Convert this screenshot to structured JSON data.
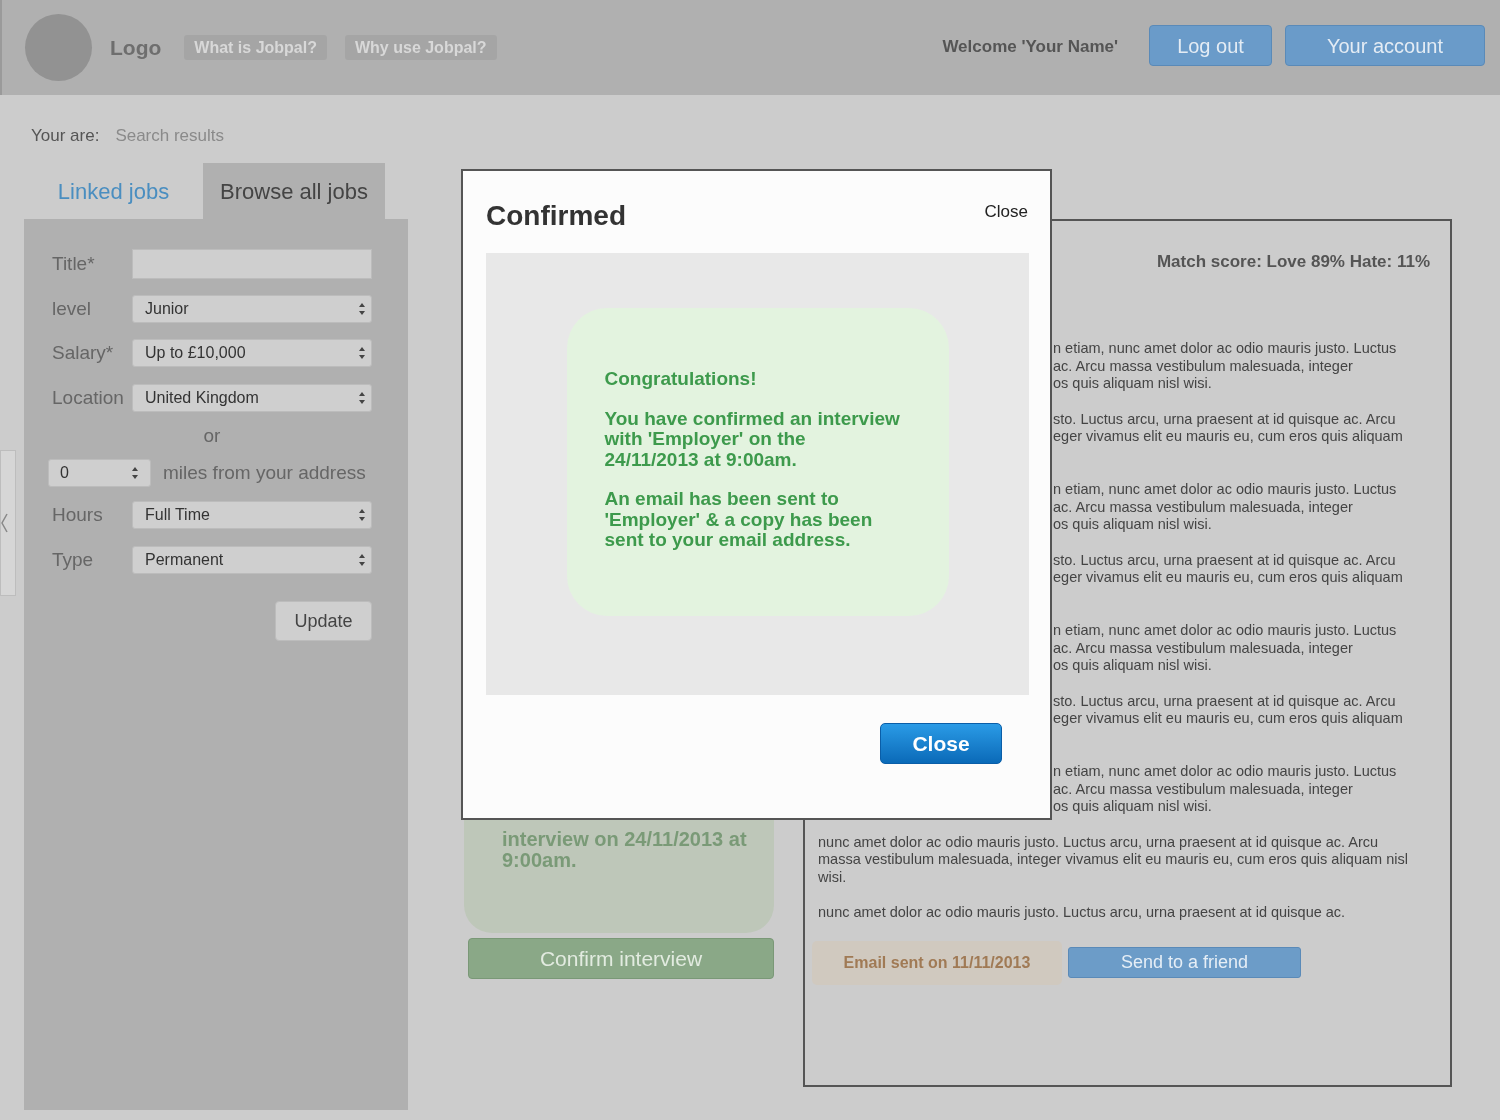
{
  "header": {
    "logo": "Logo",
    "nav": [
      "What is Jobpal?",
      "Why use Jobpal?"
    ],
    "welcome": "Welcome 'Your Name'",
    "buttons": [
      "Log out",
      "Your account"
    ]
  },
  "breadcrumb": {
    "label": "Your are:",
    "current": "Search results"
  },
  "tabs": [
    {
      "label": "Linked jobs",
      "selected": false
    },
    {
      "label": "Browse all jobs",
      "selected": true
    }
  ],
  "filters": [
    {
      "kind": "text",
      "label": "Title*"
    },
    {
      "kind": "select",
      "label": "level",
      "value": "Junior"
    },
    {
      "kind": "select",
      "label": "Salary*",
      "value": "Up to £10,000"
    },
    {
      "kind": "select",
      "label": "Location",
      "value": "United Kingdom"
    },
    {
      "kind": "separator",
      "label": "or"
    },
    {
      "kind": "distance",
      "value": "0",
      "unit": "miles from your address"
    },
    {
      "kind": "select",
      "label": "Hours",
      "value": "Full Time"
    },
    {
      "kind": "select",
      "label": "Type",
      "value": "Permanent"
    }
  ],
  "update_button": "Update",
  "job_card": {
    "text": "interview on 24/11/2013 at 9:00am.",
    "button": "Confirm interview"
  },
  "job_detail": {
    "match_score": "Match score: Love 89% Hate: 11%",
    "covered_paragraphs": [
      [
        "n etiam, nunc amet dolor ac odio mauris justo. Luctus",
        "ac. Arcu massa vestibulum malesuada, integer",
        "os quis aliquam nisl wisi."
      ],
      [
        "sto. Luctus arcu, urna praesent at id quisque ac. Arcu",
        "eger vivamus elit eu mauris eu, cum eros quis aliquam"
      ],
      [
        "n etiam, nunc amet dolor ac odio mauris justo. Luctus",
        "ac. Arcu massa vestibulum malesuada, integer",
        "os quis aliquam nisl wisi."
      ],
      [
        "sto. Luctus arcu, urna praesent at id quisque ac. Arcu",
        "eger vivamus elit eu mauris eu, cum eros quis aliquam"
      ],
      [
        "n etiam, nunc amet dolor ac odio mauris justo. Luctus",
        "ac. Arcu massa vestibulum malesuada, integer",
        "os quis aliquam nisl wisi."
      ],
      [
        "sto. Luctus arcu, urna praesent at id quisque ac. Arcu",
        "eger vivamus elit eu mauris eu, cum eros quis aliquam"
      ],
      [
        "n etiam, nunc amet dolor ac odio mauris justo. Luctus",
        "ac. Arcu massa vestibulum malesuada, integer",
        "os quis aliquam nisl wisi."
      ]
    ],
    "paragraphs": [
      "nunc amet dolor ac odio mauris justo. Luctus arcu, urna praesent at id quisque ac. Arcu massa vestibulum malesuada, integer vivamus elit eu mauris eu, cum eros quis aliquam nisl wisi.",
      "nunc amet dolor ac odio mauris justo. Luctus arcu, urna praesent at id quisque ac."
    ],
    "email_status": "Email sent on 11/11/2013",
    "share_button": "Send to a friend"
  },
  "modal": {
    "title": "Confirmed",
    "close_link": "Close",
    "message": [
      "Congratulations!",
      "You have confirmed an interview with 'Employer' on the 24/11/2013 at 9:00am.",
      "An email has been sent to 'Employer' & a copy has been sent to your email address."
    ],
    "close_button": "Close"
  }
}
